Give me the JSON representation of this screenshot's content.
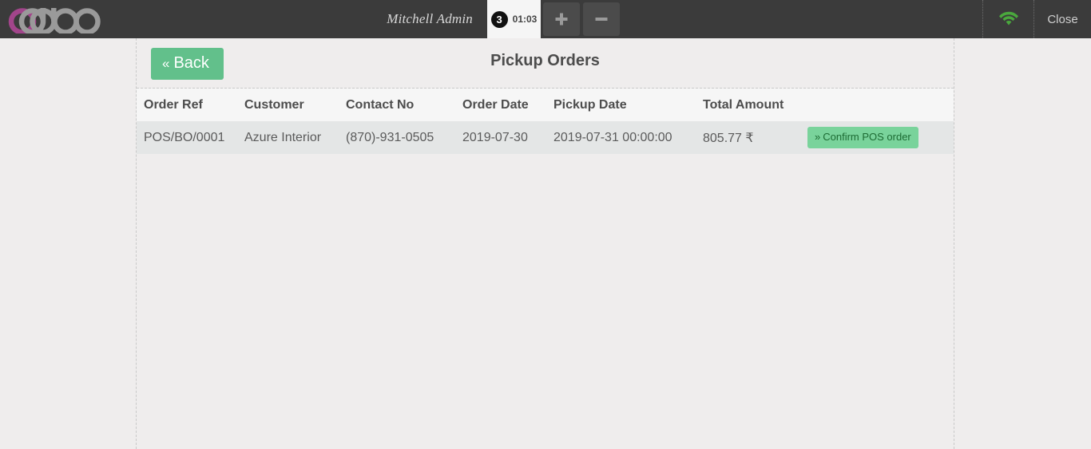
{
  "topbar": {
    "logo_text": "odoo",
    "logo_accent_color": "#A2458B",
    "logo_gray_color": "#9a9a9a",
    "username": "Mitchell Admin",
    "order_tab": {
      "order_count": "3",
      "timer": "01:03"
    },
    "add_order_label": "+",
    "remove_order_label": "−",
    "wifi_icon": "wifi-icon",
    "wifi_color": "#4aa83d",
    "close_label": "Close"
  },
  "pane": {
    "back_label": "Back",
    "back_chevron": "«",
    "title": "Pickup Orders"
  },
  "table": {
    "columns": [
      "Order Ref",
      "Customer",
      "Contact No",
      "Order Date",
      "Pickup Date",
      "Total Amount",
      ""
    ],
    "rows": [
      {
        "order_ref": "POS/BO/0001",
        "customer": "Azure Interior",
        "contact_no": "(870)-931-0505",
        "order_date": "2019-07-30",
        "pickup_date": "2019-07-31 00:00:00",
        "total_amount": "805.77 ₹",
        "action_label": "Confirm POS order",
        "action_chevron": "»"
      }
    ]
  }
}
